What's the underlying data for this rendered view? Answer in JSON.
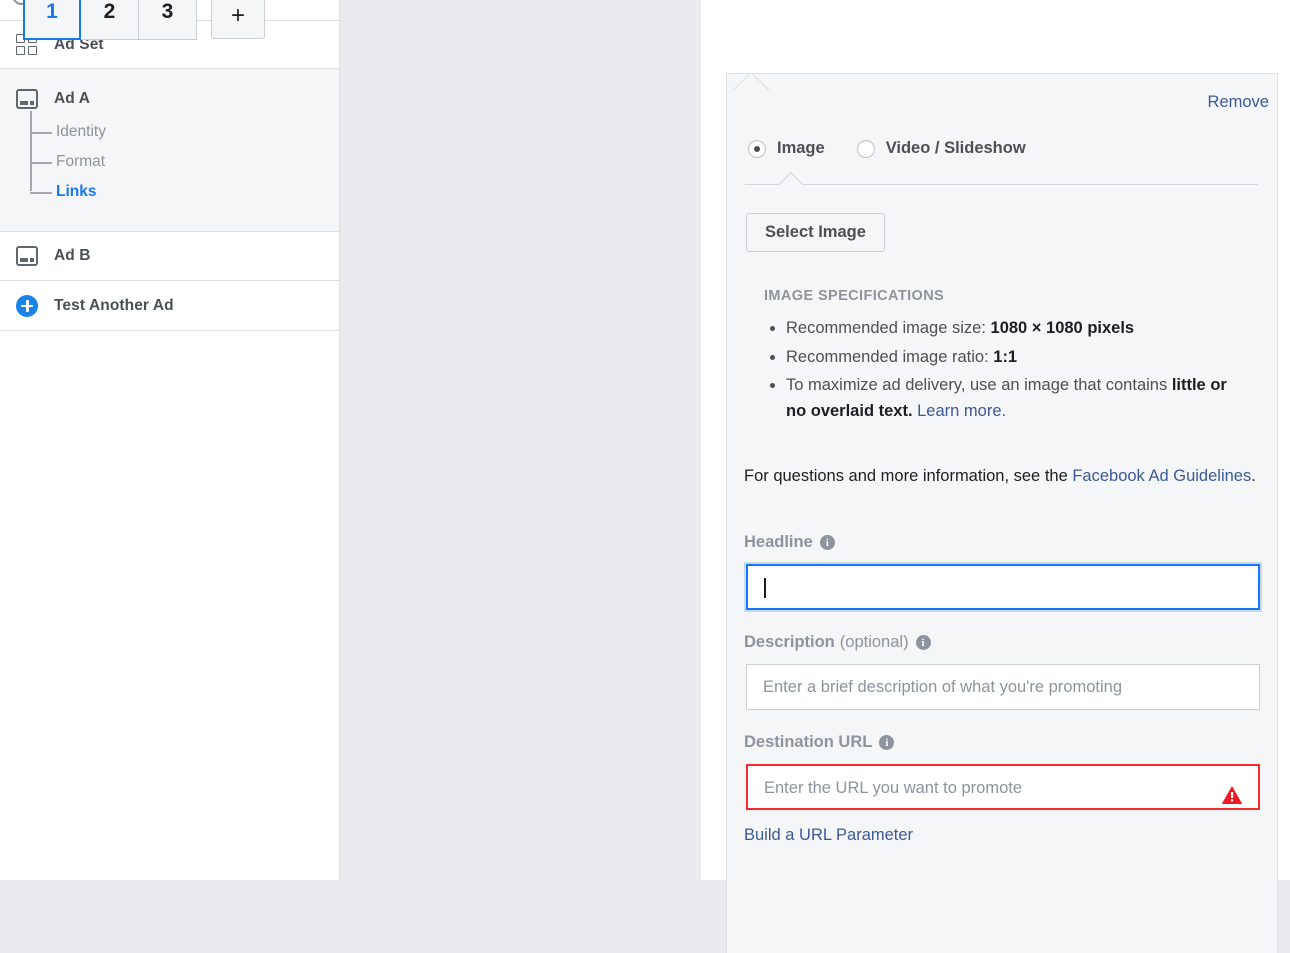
{
  "sidebar": {
    "rows": [
      {
        "label": "Ad Set",
        "icon": "grid-icon"
      },
      {
        "label": "Ad A",
        "icon": "ad-icon"
      },
      {
        "label": "Ad B",
        "icon": "ad-icon"
      },
      {
        "label": "Test Another Ad",
        "icon": "plus-circle-icon"
      }
    ],
    "ad_a_children": [
      {
        "label": "Identity",
        "active": false
      },
      {
        "label": "Format",
        "active": false
      },
      {
        "label": "Links",
        "active": true
      }
    ]
  },
  "tabs": {
    "items": [
      "1",
      "2",
      "3"
    ],
    "active": "1",
    "add_label": "+"
  },
  "panel": {
    "remove_label": "Remove",
    "media_type": {
      "options": [
        {
          "label": "Image",
          "selected": true
        },
        {
          "label": "Video / Slideshow",
          "selected": false
        }
      ]
    },
    "select_image_label": "Select Image",
    "spec_title": "IMAGE SPECIFICATIONS",
    "spec_items": [
      {
        "text": "Recommended image size: ",
        "bold": "1080 × 1080 pixels",
        "tail": ""
      },
      {
        "text": "Recommended image ratio: ",
        "bold": "1:1",
        "tail": ""
      },
      {
        "text": "To maximize ad delivery, use an image that contains ",
        "bold": "little or no overlaid text.",
        "tail": " ",
        "link": "Learn more."
      }
    ],
    "guidelines": {
      "prefix": "For questions and more information, see the ",
      "link": "Facebook Ad Guidelines",
      "suffix": "."
    },
    "headline": {
      "label": "Headline",
      "value": "",
      "placeholder": "",
      "focused": true
    },
    "description": {
      "label": "Description",
      "optional": "(optional)",
      "value": "",
      "placeholder": "Enter a brief description of what you're promoting"
    },
    "destination_url": {
      "label": "Destination URL",
      "value": "",
      "placeholder": "Enter the URL you want to promote",
      "error": true
    },
    "build_url_label": "Build a URL Parameter"
  },
  "colors": {
    "accent": "#1877f2",
    "link": "#3b5998",
    "error": "#fa2b2b",
    "panel_bg": "#f5f6f7",
    "gutter_bg": "#e9ebee",
    "text": "#4b4f56",
    "muted": "#8d949e"
  }
}
